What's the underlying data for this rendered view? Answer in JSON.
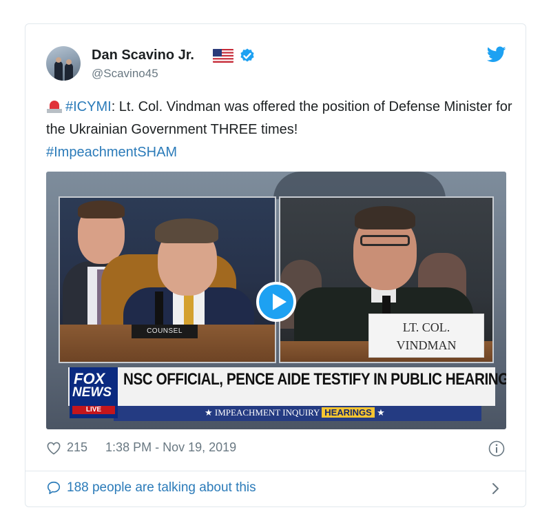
{
  "author": {
    "name": "Dan Scavino Jr.",
    "handle": "@Scavino45",
    "verified_icon": "verified-badge-icon",
    "flag_icon": "us-flag-icon"
  },
  "tweet": {
    "alert_icon": "rotating-light-icon",
    "hashtag_1": "#ICYMI",
    "body": ": Lt. Col. Vindman was offered the position of Defense Minister for the Ukrainian Government THREE times!",
    "hashtag_2": "#ImpeachmentSHAM"
  },
  "media": {
    "nameplate_left": "COUNSEL",
    "nameplate_right_line1": "LT. COL.",
    "nameplate_right_line2": "VINDMAN",
    "network_line1": "FOX",
    "network_line2": "NEWS",
    "live_label": "LIVE",
    "headline": "NSC OFFICIAL, PENCE AIDE TESTIFY IN PUBLIC HEARING",
    "subline_prefix": "★ IMPEACHMENT INQUIRY",
    "subline_highlight": "HEARINGS",
    "subline_suffix": "★"
  },
  "footer": {
    "likes": "215",
    "timestamp": "1:38 PM - Nov 19, 2019",
    "talking": "188 people are talking about this"
  },
  "colors": {
    "link": "#2b7bb9",
    "twitter_blue": "#1da1f2",
    "muted": "#697882"
  }
}
